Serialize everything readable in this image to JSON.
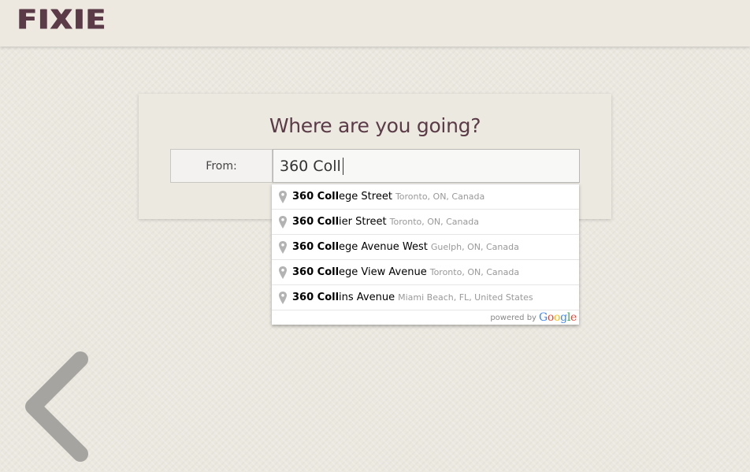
{
  "header": {
    "logo_text": "FIXIE"
  },
  "card": {
    "title": "Where are you going?",
    "from_label": "From:",
    "from_value": "360 Coll"
  },
  "suggestions": [
    {
      "match": "360 Coll",
      "rest": "ege Street",
      "secondary": "Toronto, ON, Canada"
    },
    {
      "match": "360 Coll",
      "rest": "ier Street",
      "secondary": "Toronto, ON, Canada"
    },
    {
      "match": "360 Coll",
      "rest": "ege Avenue West",
      "secondary": "Guelph, ON, Canada"
    },
    {
      "match": "360 Coll",
      "rest": "ege View Avenue",
      "secondary": "Toronto, ON, Canada"
    },
    {
      "match": "360 Coll",
      "rest": "ins Avenue",
      "secondary": "Miami Beach, FL, United States"
    }
  ],
  "footer": {
    "powered_by": "powered by",
    "google_letters": [
      "G",
      "o",
      "o",
      "g",
      "l",
      "e"
    ]
  },
  "icons": {
    "back": "chevron-left-icon",
    "pin": "map-pin-icon"
  },
  "colors": {
    "brand": "#5b3b47",
    "google": [
      "#4285f4",
      "#ea4335",
      "#fbbc05",
      "#4285f4",
      "#34a853",
      "#ea4335"
    ]
  }
}
